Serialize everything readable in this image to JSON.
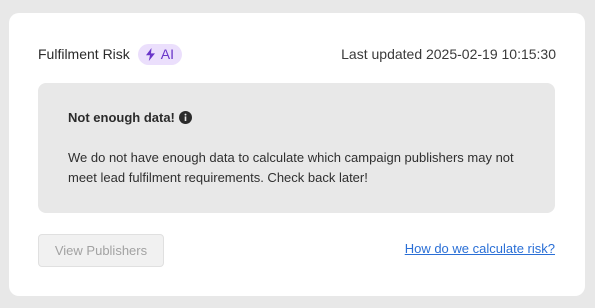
{
  "header": {
    "title": "Fulfilment Risk",
    "badge_label": "AI",
    "badge_icon": "lightning-bolt-icon",
    "last_updated": "Last updated 2025-02-19 10:15:30"
  },
  "notice": {
    "title": "Not enough data!",
    "title_icon": "info-icon",
    "body": "We do not have enough data to calculate which campaign publishers may not meet lead fulfilment requirements. Check back later!"
  },
  "actions": {
    "view_publishers_label": "View Publishers",
    "view_publishers_disabled": true,
    "help_link_label": "How do we calculate risk?"
  },
  "colors": {
    "page_bg": "#e8e8e8",
    "card_bg": "#ffffff",
    "notice_bg": "#e8e8e8",
    "badge_bg": "#ebdffc",
    "badge_text": "#6a35c9",
    "link": "#2a6fd6",
    "disabled_text": "#a2a2a2"
  }
}
